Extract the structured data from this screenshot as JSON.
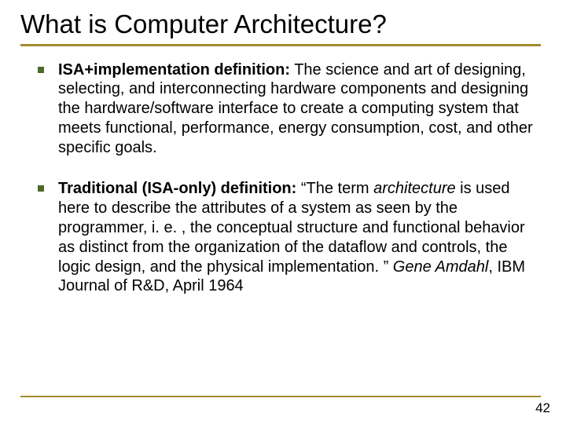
{
  "title": "What is Computer Architecture?",
  "items": [
    {
      "lead": "ISA+implementation definition:",
      "rest": " The science and art of designing, selecting, and interconnecting hardware components and designing the hardware/software interface to create a computing system that meets functional, performance, energy consumption, cost, and other specific goals."
    },
    {
      "lead": "Traditional (ISA-only) definition:",
      "pre_italic": " “The term ",
      "italic1": "architecture",
      "mid": " is used here to describe the attributes of a system as seen by the programmer, i. e. , the conceptual structure and functional behavior as distinct from the organization of the dataflow and controls, the logic design, and the physical implementation. ” ",
      "italic2": "Gene Amdahl",
      "post": ", IBM Journal of R&D, April 1964"
    }
  ],
  "page_number": "42"
}
